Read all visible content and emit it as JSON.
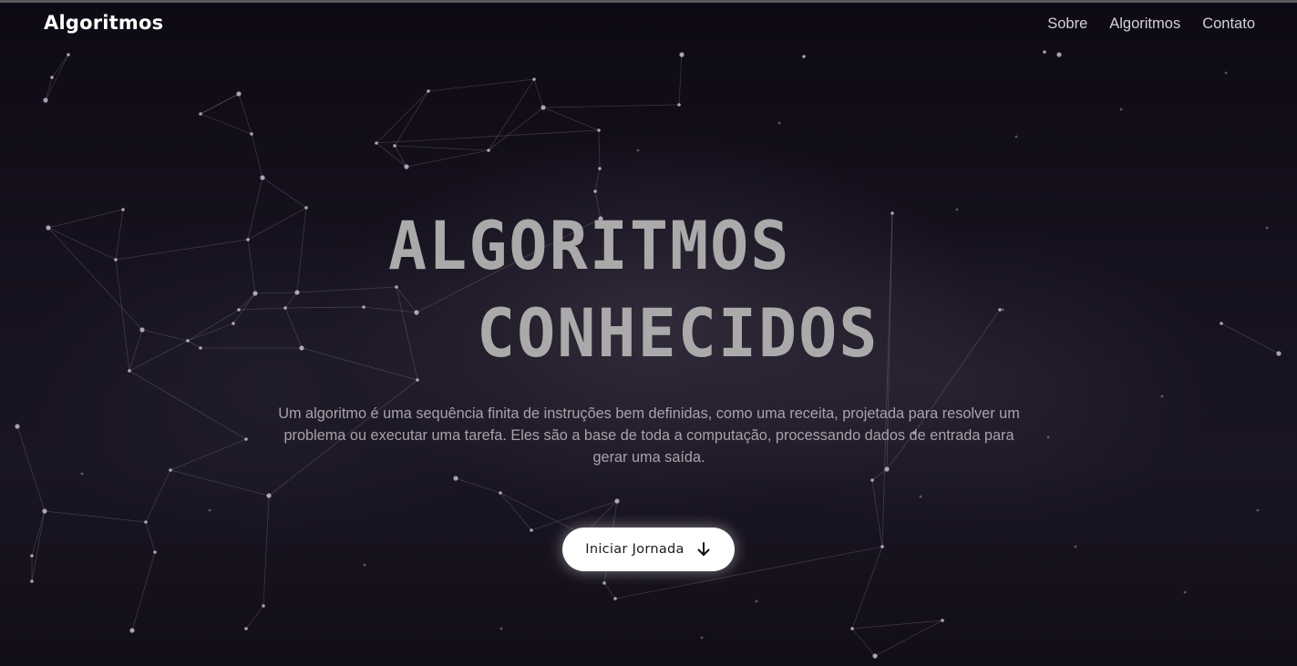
{
  "nav": {
    "brand": "Algoritmos",
    "links": [
      "Sobre",
      "Algoritmos",
      "Contato"
    ]
  },
  "hero": {
    "title_line1": "ALGORITMOS",
    "title_line2": "CONHECIDOS",
    "description": "Um algoritmo é uma sequência finita de instruções bem definidas, como uma receita, projetada para resolver um problema ou executar uma tarefa. Eles são a base de toda a computação, processando dados de entrada para gerar uma saída.",
    "cta_label": "Iniciar Jornada",
    "cta_icon": "arrow-down-icon"
  },
  "colors": {
    "background": "#0f0b16",
    "title": "#aaaaaa",
    "text": "#a7a3ab",
    "button": "#ffffff"
  }
}
